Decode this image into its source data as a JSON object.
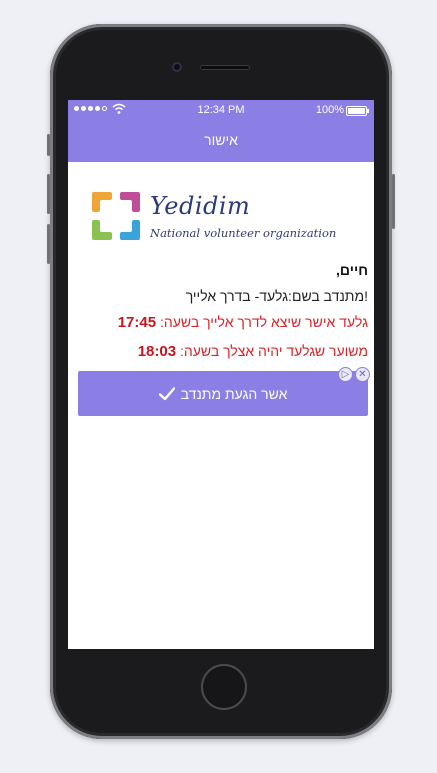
{
  "status_bar": {
    "time": "12:34 PM",
    "battery": "100%"
  },
  "nav": {
    "title": "אישור"
  },
  "logo": {
    "name": "Yedidim",
    "tagline": "National volunteer organization",
    "colors": [
      "#f0a53a",
      "#c04d97",
      "#8cc152",
      "#3aa4d8"
    ]
  },
  "message": {
    "greeting": "חיים,",
    "volunteer_line": "!מתנדב בשם:גלעד- בדרך אלייך",
    "departure_text": "גלעד אישר שיצא לדרך אלייך בשעה: ",
    "departure_time": "17:45",
    "arrival_text": "משוער שגלעד יהיה אצלך בשעה: ",
    "arrival_time": "18:03"
  },
  "actions": {
    "confirm_label": "אשר הגעת מתנדב"
  },
  "theme": {
    "accent": "#8b7ee4",
    "alert": "#d6262b"
  }
}
